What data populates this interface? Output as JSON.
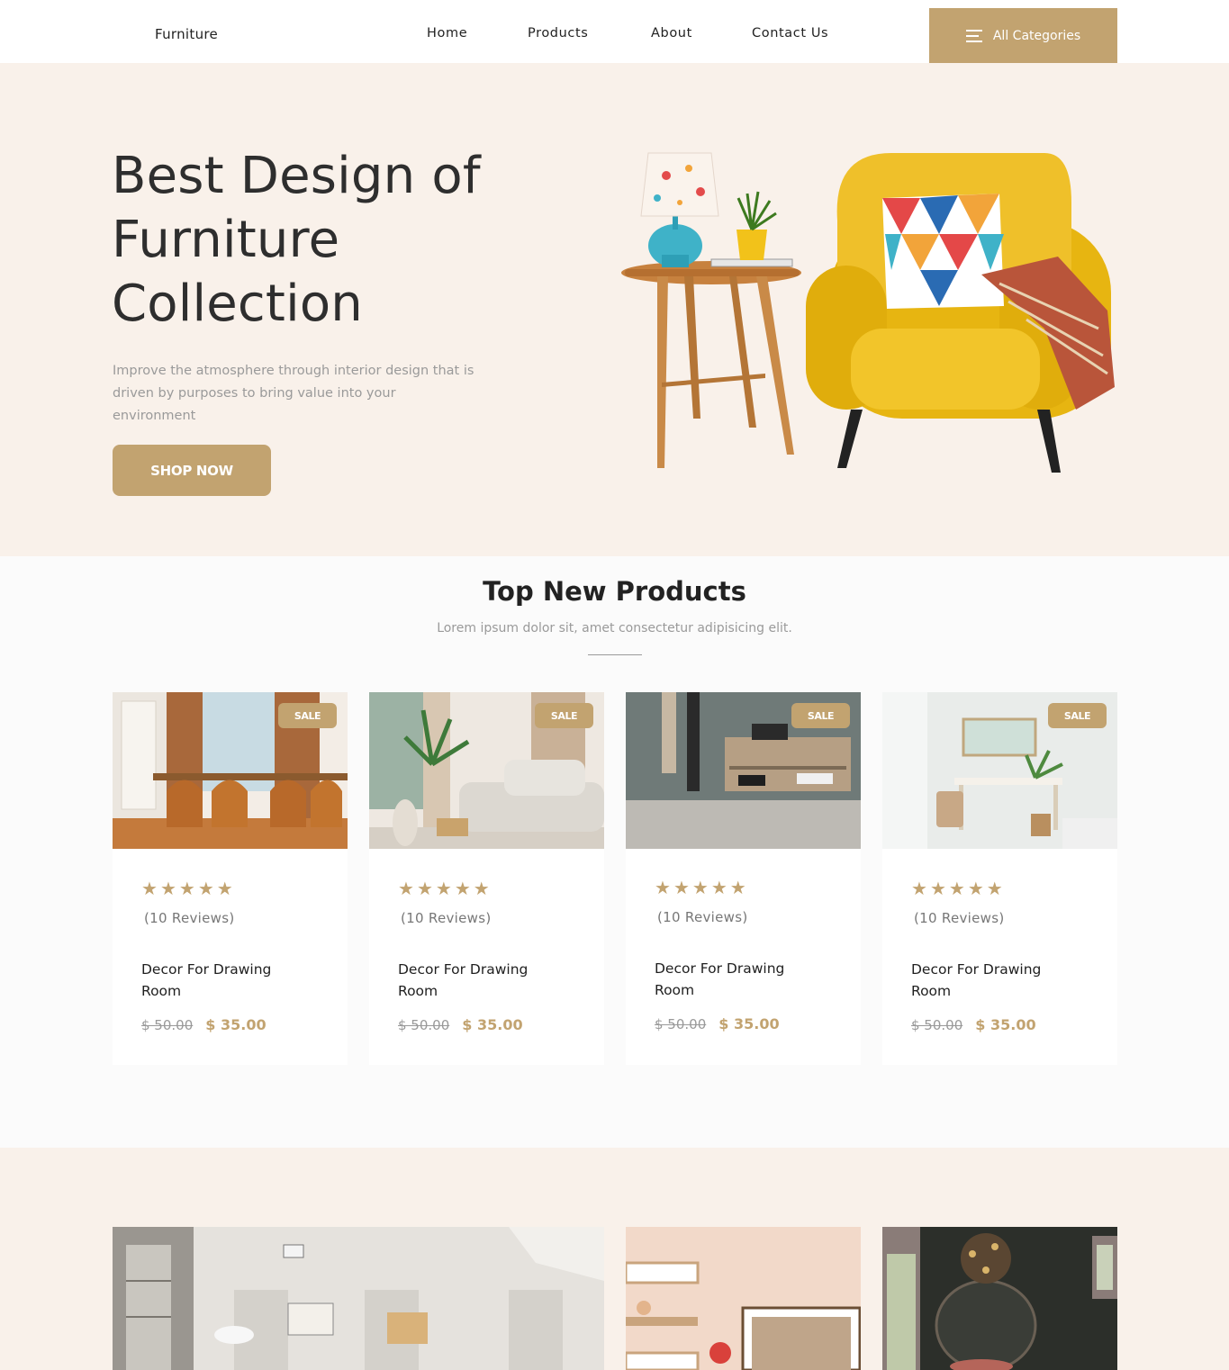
{
  "header": {
    "logo": "Furniture",
    "nav": [
      {
        "label": "Home"
      },
      {
        "label": "Products"
      },
      {
        "label": "About"
      },
      {
        "label": "Contact Us"
      }
    ],
    "categories_button": "All Categories"
  },
  "hero": {
    "title_lines": [
      "Best Design of",
      "Furniture",
      "Collection"
    ],
    "description": "Improve the atmosphere through interior design that is driven by purposes to bring value into your environment",
    "cta": "SHOP NOW"
  },
  "products": {
    "title": "Top New Products",
    "subtitle": "Lorem ipsum dolor sit, amet consectetur adipisicing elit.",
    "items": [
      {
        "badge": "SALE",
        "rating": 5,
        "reviews": "(10 Reviews)",
        "name": "Decor For Drawing Room",
        "old_price": "$ 50.00",
        "price": "$ 35.00"
      },
      {
        "badge": "SALE",
        "rating": 5,
        "reviews": "(10 Reviews)",
        "name": "Decor For Drawing Room",
        "old_price": "$ 50.00",
        "price": "$ 35.00"
      },
      {
        "badge": "SALE",
        "rating": 5,
        "reviews": "(10 Reviews)",
        "name": "Decor For Drawing Room",
        "old_price": "$ 50.00",
        "price": "$ 35.00"
      },
      {
        "badge": "SALE",
        "rating": 5,
        "reviews": "(10 Reviews)",
        "name": "Decor For Drawing Room",
        "old_price": "$ 50.00",
        "price": "$ 35.00"
      }
    ]
  },
  "colors": {
    "accent": "#c2a370",
    "hero_bg": "#f9f1ea",
    "section_bg": "#fbfbfb"
  }
}
